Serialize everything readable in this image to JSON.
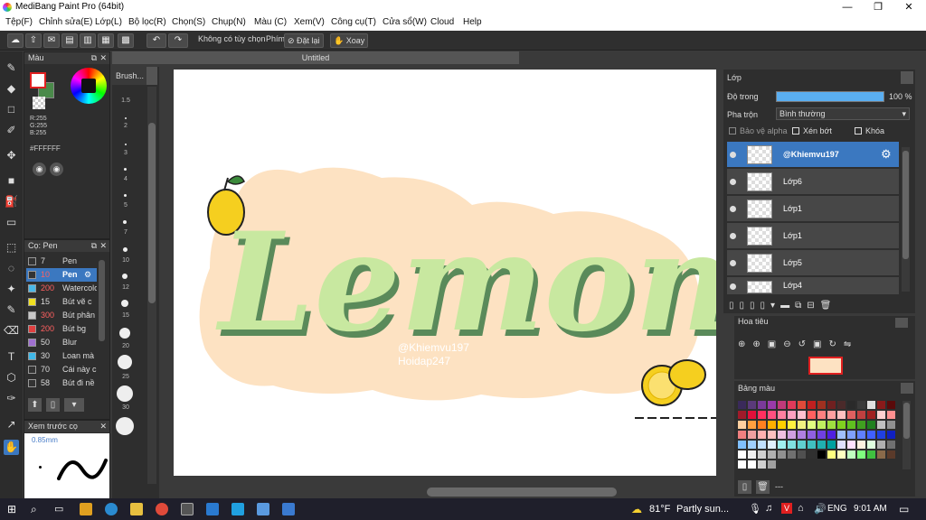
{
  "window": {
    "title": "MediBang Paint Pro (64bit)",
    "minimize": "—",
    "maximize": "❐",
    "close": "✕"
  },
  "menu": [
    "Tệp(F)",
    "Chỉnh sửa(E)",
    "Lớp(L)",
    "Bộ lọc(R)",
    "Chọn(S)",
    "Chụp(N)",
    "Màu (C)",
    "Xem(V)",
    "Công cụ(T)",
    "Cửa sổ(W)",
    "Cloud",
    "Help"
  ],
  "toolbar": {
    "no_option": "Không có tùy chọn",
    "key_label": "Phím",
    "reset": "Đặt lại",
    "rotate": "Xoay"
  },
  "document": {
    "tab_title": "Untitled"
  },
  "color_panel": {
    "title": "Màu",
    "r": "R:255",
    "g": "G:255",
    "b": "B:255",
    "hex": "#FFFFFF",
    "fg_color": "#e02020",
    "bg_color": "#4a8a4a"
  },
  "brush_panel": {
    "title": "Cọ: Pen",
    "items": [
      {
        "size": "7",
        "name": "Pen",
        "color": "#333333"
      },
      {
        "size": "10",
        "name": "Pen",
        "color": "#333333"
      },
      {
        "size": "200",
        "name": "Watercolor",
        "color": "#4ab8e8"
      },
      {
        "size": "15",
        "name": "Bút vẽ c",
        "color": "#f0e020"
      },
      {
        "size": "300",
        "name": "Bút phân",
        "color": "#c8c8c8"
      },
      {
        "size": "200",
        "name": "Bút bg",
        "color": "#e04040"
      },
      {
        "size": "50",
        "name": "Blur",
        "color": "#a070d0"
      },
      {
        "size": "30",
        "name": "Loan mà",
        "color": "#40b8e8"
      },
      {
        "size": "70",
        "name": "Cái này c",
        "color": "#333333"
      },
      {
        "size": "58",
        "name": "Bút đi nề",
        "color": "#333333"
      }
    ]
  },
  "preview_panel": {
    "title": "Xem trước cọ",
    "size": "0.85mm"
  },
  "size_panel": {
    "title": "Brush...",
    "sizes": [
      "1.5",
      "2",
      "3",
      "4",
      "5",
      "7",
      "10",
      "12",
      "15",
      "20",
      "25",
      "30"
    ]
  },
  "canvas": {
    "main_text": "Lemon",
    "watermark_1": "@Khiemvu197",
    "watermark_2": "Hoidap247"
  },
  "layer_panel": {
    "title": "Lớp",
    "opacity_label": "Độ trong",
    "opacity_value": "100 %",
    "opacity_fraction": 1.0,
    "blend_label": "Pha trộn",
    "blend_value": "Bình thường",
    "protect_alpha": "Bảo vệ alpha",
    "clipping": "Xén bớt",
    "lock": "Khóa",
    "layers": [
      "@Khiemvu197",
      "Lớp6",
      "Lớp1",
      "Lớp1",
      "Lớp5",
      "Lớp4"
    ]
  },
  "nav_panel": {
    "title": "Hoa tiêu"
  },
  "palette_panel": {
    "title": "Bảng màu",
    "footer": "---"
  },
  "taskbar": {
    "temp": "81°F",
    "weather": "Partly sun...",
    "lang": "ENG",
    "time": "9:01 AM"
  }
}
